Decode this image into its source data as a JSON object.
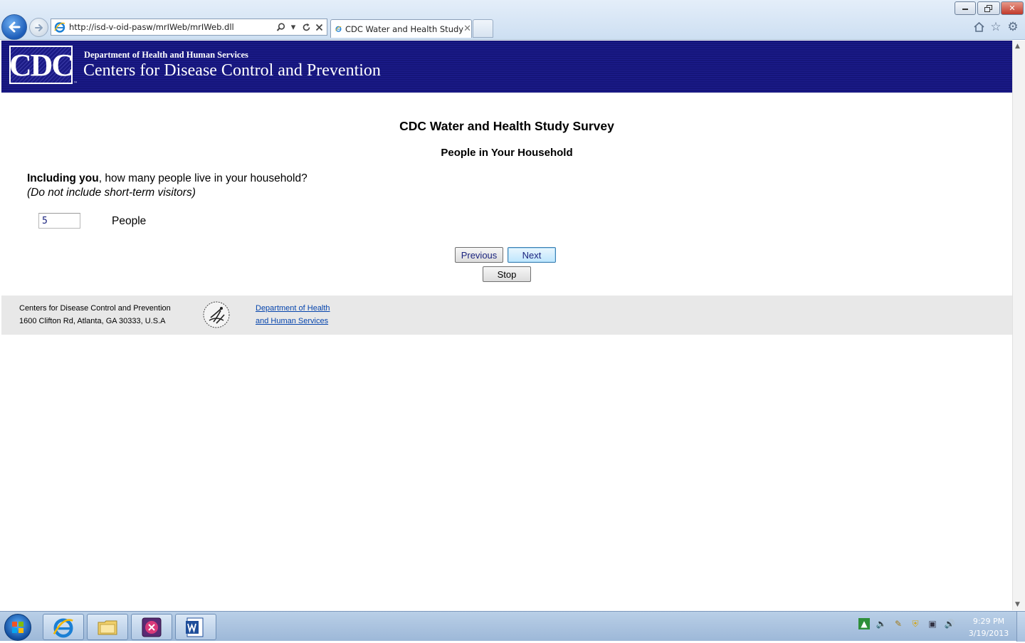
{
  "browser": {
    "url": "http://isd-v-oid-pasw/mrIWeb/mrIWeb.dll",
    "tab_title": "CDC Water and Health Study",
    "icons": [
      "back-arrow-icon",
      "forward-arrow-icon",
      "ie-icon",
      "search-icon",
      "dropdown-icon",
      "refresh-icon",
      "stop-icon",
      "home-icon",
      "favorites-star-icon",
      "tools-gear-icon"
    ]
  },
  "banner": {
    "logo_text": "CDC",
    "department": "Department of Health and Human Services",
    "agency": "Centers for Disease Control and Prevention",
    "background_color": "#15157a"
  },
  "survey": {
    "title": "CDC Water and Health Study Survey",
    "section": "People in Your Household",
    "question_bold": "Including you",
    "question_rest": ", how many people live in your household?",
    "instruction": "(Do not include short-term visitors)",
    "answer_value": "5",
    "answer_unit": "People",
    "buttons": {
      "previous": "Previous",
      "next": "Next",
      "stop": "Stop"
    }
  },
  "footer": {
    "org_name": "Centers for Disease Control and Prevention",
    "address": "1600 Clifton Rd, Atlanta, GA 30333, U.S.A",
    "link_line1": "Department of Health",
    "link_line2": "and Human Services"
  },
  "taskbar": {
    "items": [
      "start-orb",
      "internet-explorer",
      "windows-explorer",
      "media-app",
      "microsoft-word"
    ],
    "time": "9:29 PM",
    "date": "3/19/2013"
  }
}
